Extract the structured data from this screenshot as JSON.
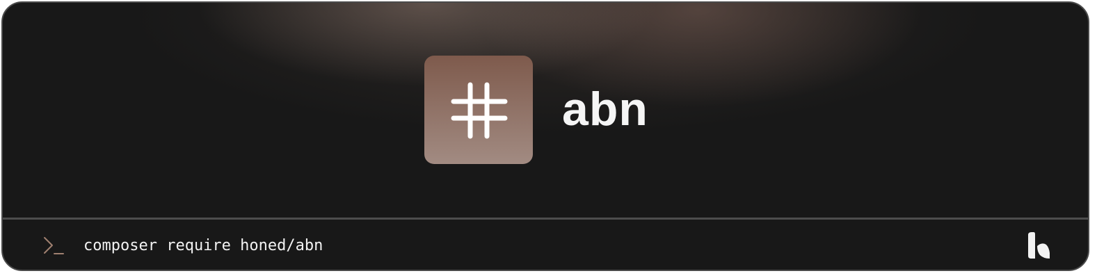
{
  "package": {
    "name": "abn",
    "icon": "hash-icon"
  },
  "footer": {
    "prompt_icon": "terminal-prompt-icon",
    "command": "composer require honed/abn",
    "brand_icon": "honed-logo-icon"
  },
  "colors": {
    "background": "#181818",
    "border": "#4a4a4a",
    "logo_gradient_top": "#7e5a4c",
    "logo_gradient_bottom": "#a28b82",
    "prompt_accent": "#a08070",
    "text": "#f5f5f5"
  }
}
